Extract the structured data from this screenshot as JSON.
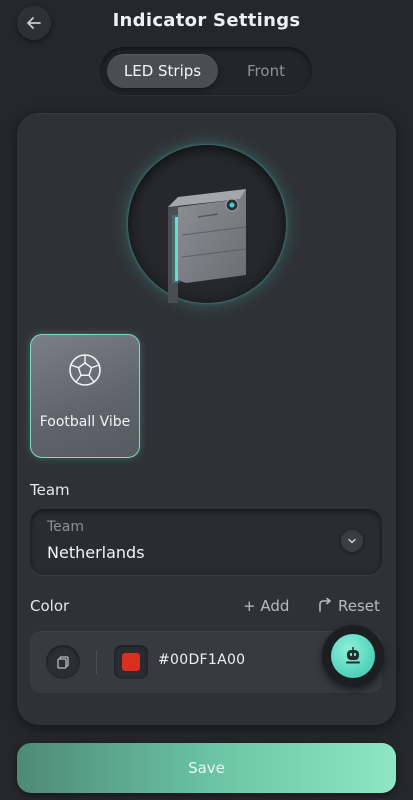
{
  "header": {
    "title": "Indicator Settings",
    "back_icon": "arrow-left-icon"
  },
  "tabs": [
    {
      "label": "LED Strips",
      "active": true
    },
    {
      "label": "Front",
      "active": false
    }
  ],
  "device": {
    "glow_color": "#46c8be"
  },
  "modes": [
    {
      "label": "Football Vibe",
      "icon": "football-icon",
      "selected": true
    }
  ],
  "team": {
    "title": "Team",
    "field_label": "Team",
    "value": "Netherlands"
  },
  "color": {
    "title": "Color",
    "add_label": "+ Add",
    "reset_label": "Reset",
    "entries": [
      {
        "hex": "#00DF1A00",
        "swatch_color": "#d7301f"
      }
    ]
  },
  "save_label": "Save",
  "theme": {
    "accent": "#6cc7a7",
    "background": "#25272b"
  }
}
